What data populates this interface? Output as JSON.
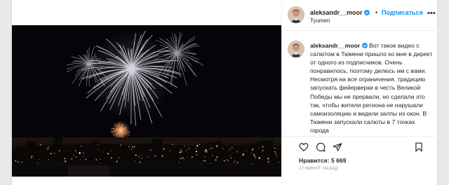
{
  "post": {
    "username": "aleksandr__moor",
    "follow_label": "Подписаться",
    "separator": "•",
    "location": "Tyumen",
    "more_icon": "•••",
    "caption": "Вот такое видео с салютом в Тюмени пришло ко мне в директ от одного из подписчиков. Очень понравилось, поэтому делюсь им с вами. Несмотря на все ограничения, традицию запускать фейерверки в честь Великой Победы мы не прервали, но сделали это так, чтобы жители региона не нарушали самоизоляцию и видели залпы из окон. В Тюмени запускали салюты в 7 точках города",
    "likes_text": "Нравится: 5 669",
    "timestamp": "27 МИНУТ НАЗАД"
  },
  "icons": {
    "like": "heart-icon",
    "comment": "comment-icon",
    "share": "paper-plane-icon",
    "save": "bookmark-icon",
    "verified": "verified-badge-icon"
  },
  "colors": {
    "link_blue": "#0095f6",
    "verified_blue": "#3897f0",
    "text": "#262626",
    "muted": "#8e8e8e",
    "video_bg": "#05040a"
  }
}
